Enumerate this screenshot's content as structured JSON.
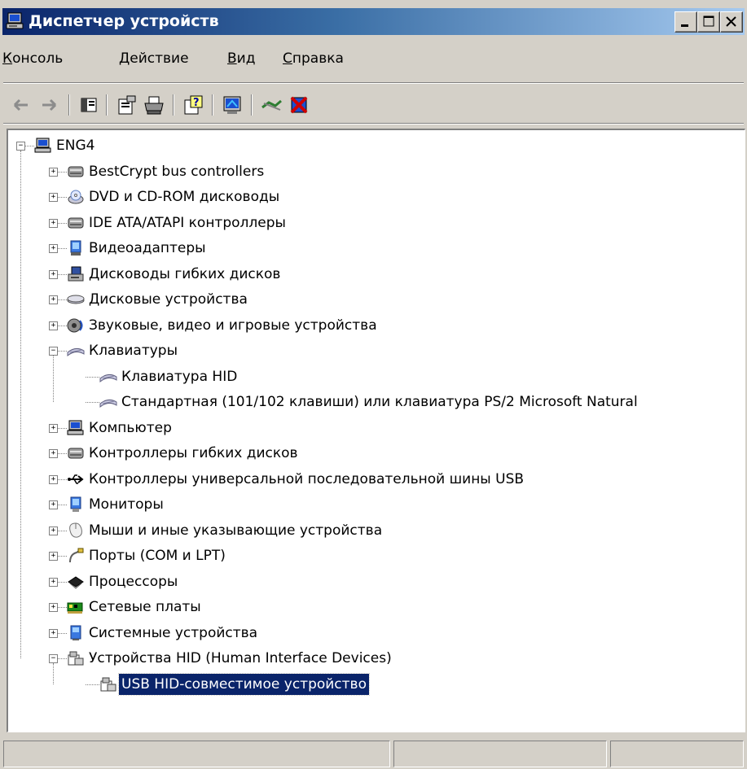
{
  "window": {
    "title": "Диспетчер устройств",
    "title_icon": "device-manager-icon",
    "buttons": [
      "minimize",
      "maximize",
      "close"
    ]
  },
  "menu": [
    {
      "first": "К",
      "rest": "онсоль"
    },
    {
      "first": "Д",
      "rest": "ействие"
    },
    {
      "first": "В",
      "rest": "ид"
    },
    {
      "first": "С",
      "rest": "правка"
    }
  ],
  "toolbar": {
    "buttons": [
      "back",
      "forward",
      "show-hide-console-tree",
      "properties",
      "print",
      "help",
      "scan-hardware",
      "disable-device",
      "uninstall-device"
    ]
  },
  "tree": {
    "root": "ENG4",
    "categories": [
      {
        "label": "BestCrypt bus controllers",
        "icon": "controller-icon",
        "expanded": false
      },
      {
        "label": "DVD и CD-ROM дисководы",
        "icon": "cdrom-icon",
        "expanded": false
      },
      {
        "label": "IDE ATA/ATAPI контроллеры",
        "icon": "controller-icon",
        "expanded": false
      },
      {
        "label": "Видеоадаптеры",
        "icon": "display-adapter-icon",
        "expanded": false
      },
      {
        "label": "Дисководы гибких дисков",
        "icon": "floppy-drive-icon",
        "expanded": false
      },
      {
        "label": "Дисковые устройства",
        "icon": "disk-drive-icon",
        "expanded": false
      },
      {
        "label": "Звуковые, видео и игровые устройства",
        "icon": "sound-icon",
        "expanded": false
      },
      {
        "label": "Клавиатуры",
        "icon": "keyboard-icon",
        "expanded": true,
        "children": [
          {
            "label": "Клавиатура HID",
            "icon": "keyboard-icon"
          },
          {
            "label": "Стандартная (101/102 клавиши) или клавиатура PS/2 Microsoft Natural",
            "icon": "keyboard-icon"
          }
        ]
      },
      {
        "label": "Компьютер",
        "icon": "computer-icon",
        "expanded": false
      },
      {
        "label": "Контроллеры гибких дисков",
        "icon": "controller-icon",
        "expanded": false
      },
      {
        "label": "Контроллеры универсальной последовательной шины USB",
        "icon": "usb-icon",
        "expanded": false
      },
      {
        "label": "Мониторы",
        "icon": "monitor-icon",
        "expanded": false
      },
      {
        "label": "Мыши и иные указывающие устройства",
        "icon": "mouse-icon",
        "expanded": false
      },
      {
        "label": "Порты (COM и LPT)",
        "icon": "port-icon",
        "expanded": false
      },
      {
        "label": "Процессоры",
        "icon": "processor-icon",
        "expanded": false
      },
      {
        "label": "Сетевые платы",
        "icon": "network-adapter-icon",
        "expanded": false
      },
      {
        "label": "Системные устройства",
        "icon": "system-devices-icon",
        "expanded": false
      },
      {
        "label": "Устройства HID (Human Interface Devices)",
        "icon": "hid-icon",
        "expanded": true,
        "children": [
          {
            "label": "USB HID-совместимое устройство",
            "icon": "hid-icon",
            "selected": true
          }
        ]
      }
    ]
  },
  "colors": {
    "title_start": "#0a246a",
    "title_end": "#a6caf0",
    "selection": "#0a246a",
    "face": "#d4d0c8"
  }
}
